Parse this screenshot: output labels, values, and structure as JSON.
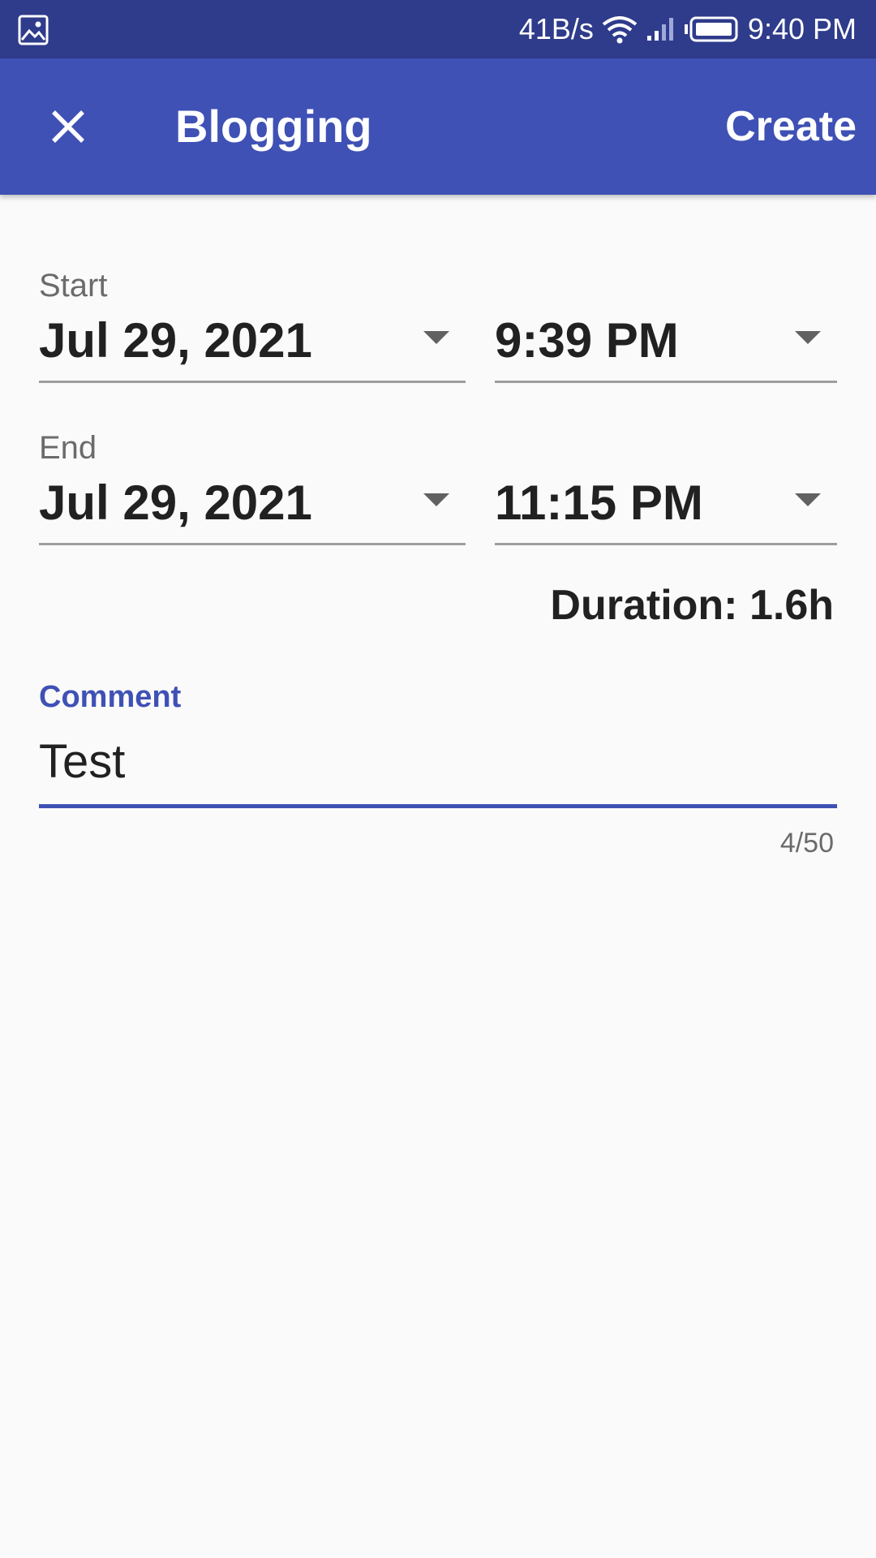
{
  "status_bar": {
    "network_speed": "41B/s",
    "time": "9:40 PM",
    "icons": [
      "image-icon",
      "wifi-icon",
      "signal-icon",
      "battery-icon"
    ]
  },
  "app_bar": {
    "title": "Blogging",
    "close_icon": "close-icon",
    "create_label": "Create"
  },
  "form": {
    "start": {
      "label": "Start",
      "date": "Jul 29, 2021",
      "time": "9:39 PM"
    },
    "end": {
      "label": "End",
      "date": "Jul 29, 2021",
      "time": "11:15 PM"
    },
    "duration": "Duration: 1.6h",
    "comment": {
      "label": "Comment",
      "value": "Test",
      "counter": "4/50"
    }
  },
  "colors": {
    "status_bar": "#2f3b8b",
    "primary": "#3f51b5",
    "background": "#fafafa",
    "text": "#212121",
    "secondary_text": "#6b6b6b"
  }
}
